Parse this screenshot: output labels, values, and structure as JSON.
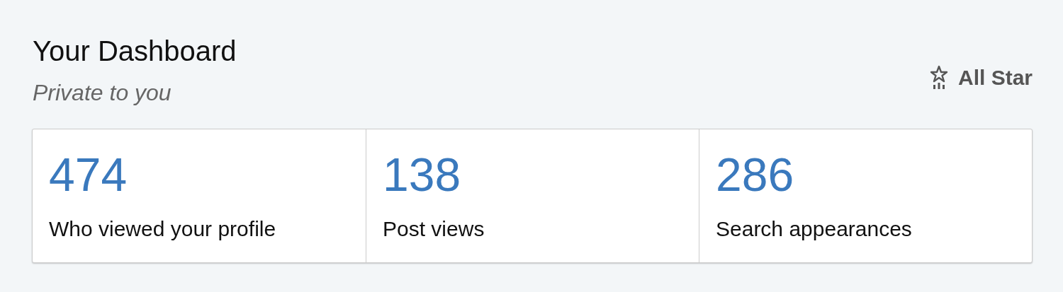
{
  "header": {
    "title": "Your Dashboard",
    "subtitle": "Private to you",
    "badge": "All Star"
  },
  "stats": [
    {
      "value": "474",
      "label": "Who viewed your profile"
    },
    {
      "value": "138",
      "label": "Post views"
    },
    {
      "value": "286",
      "label": "Search appearances"
    }
  ]
}
